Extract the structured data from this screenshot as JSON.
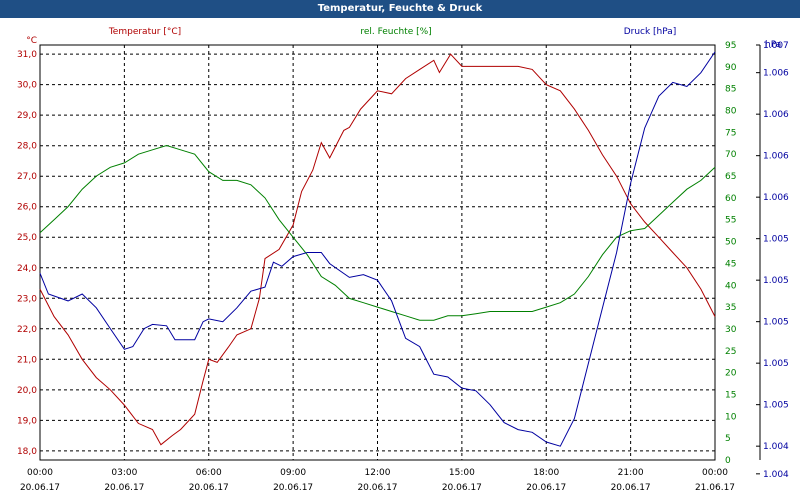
{
  "window": {
    "title": "Temperatur, Feuchte & Druck"
  },
  "chart_data": {
    "type": "line",
    "title": "Temperatur, Feuchte & Druck",
    "grid": true,
    "x_ticks": [
      {
        "time": "00:00",
        "date": "20.06.17"
      },
      {
        "time": "03:00",
        "date": "20.06.17"
      },
      {
        "time": "06:00",
        "date": "20.06.17"
      },
      {
        "time": "09:00",
        "date": "20.06.17"
      },
      {
        "time": "12:00",
        "date": "20.06.17"
      },
      {
        "time": "15:00",
        "date": "20.06.17"
      },
      {
        "time": "18:00",
        "date": "20.06.17"
      },
      {
        "time": "21:00",
        "date": "20.06.17"
      },
      {
        "time": "00:00",
        "date": "21.06.17"
      }
    ],
    "xlim": [
      0,
      24
    ],
    "axes": {
      "temperature": {
        "unit": "°C",
        "ylim": [
          17.7,
          31.3
        ],
        "ticks": [
          "31,0",
          "30,0",
          "29,0",
          "28,0",
          "27,0",
          "26,0",
          "25,0",
          "24,0",
          "23,0",
          "22,0",
          "21,0",
          "20,0",
          "19,0",
          "18,0"
        ],
        "tick_values": [
          31,
          30,
          29,
          28,
          27,
          26,
          25,
          24,
          23,
          22,
          21,
          20,
          19,
          18
        ]
      },
      "humidity": {
        "unit": "%",
        "ylim": [
          0,
          95
        ],
        "ticks": [
          "95",
          "90",
          "85",
          "80",
          "75",
          "70",
          "65",
          "60",
          "55",
          "50",
          "45",
          "40",
          "35",
          "30",
          "25",
          "20",
          "15",
          "10",
          "5",
          "0"
        ],
        "tick_values": [
          95,
          90,
          85,
          80,
          75,
          70,
          65,
          60,
          55,
          50,
          45,
          40,
          35,
          30,
          25,
          20,
          15,
          10,
          5,
          0
        ]
      },
      "pressure": {
        "unit": "hPa",
        "ylim": [
          1.004,
          1.007
        ],
        "ticks": [
          "1.007",
          "1.006",
          "1.006",
          "1.006",
          "1.006",
          "1.005",
          "1.005",
          "1.005",
          "1.005",
          "1.005",
          "1.004",
          "1.004"
        ],
        "tick_values": [
          1.007,
          1.0068,
          1.0065,
          1.0062,
          1.0059,
          1.0056,
          1.0053,
          1.005,
          1.0047,
          1.0044,
          1.0041,
          1.0039
        ]
      }
    },
    "colors": {
      "temperature": "#b00000",
      "humidity": "#008000",
      "pressure": "#0000a0",
      "grid": "#000000"
    },
    "series": [
      {
        "name": "Temperatur [°C]",
        "axis": "temperature",
        "points": [
          [
            0,
            23.3
          ],
          [
            0.5,
            22.4
          ],
          [
            1,
            21.8
          ],
          [
            1.5,
            21
          ],
          [
            2,
            20.4
          ],
          [
            2.5,
            20
          ],
          [
            3,
            19.5
          ],
          [
            3.5,
            18.9
          ],
          [
            4,
            18.7
          ],
          [
            4.3,
            18.2
          ],
          [
            4.7,
            18.5
          ],
          [
            5,
            18.7
          ],
          [
            5.5,
            19.2
          ],
          [
            5.8,
            20.3
          ],
          [
            6,
            21
          ],
          [
            6.3,
            20.9
          ],
          [
            6.7,
            21.4
          ],
          [
            7,
            21.8
          ],
          [
            7.5,
            22
          ],
          [
            7.8,
            23
          ],
          [
            8,
            24.3
          ],
          [
            8.5,
            24.6
          ],
          [
            9,
            25.4
          ],
          [
            9.3,
            26.5
          ],
          [
            9.7,
            27.2
          ],
          [
            10,
            28.1
          ],
          [
            10.3,
            27.6
          ],
          [
            10.8,
            28.5
          ],
          [
            11,
            28.6
          ],
          [
            11.4,
            29.2
          ],
          [
            11.8,
            29.6
          ],
          [
            12,
            29.8
          ],
          [
            12.5,
            29.7
          ],
          [
            13,
            30.2
          ],
          [
            13.5,
            30.5
          ],
          [
            14,
            30.8
          ],
          [
            14.2,
            30.4
          ],
          [
            14.6,
            31
          ],
          [
            15,
            30.6
          ],
          [
            15.5,
            30.6
          ],
          [
            16,
            30.6
          ],
          [
            17,
            30.6
          ],
          [
            17.5,
            30.5
          ],
          [
            18,
            30
          ],
          [
            18.5,
            29.8
          ],
          [
            19,
            29.2
          ],
          [
            19.5,
            28.5
          ],
          [
            20,
            27.7
          ],
          [
            20.5,
            27
          ],
          [
            21,
            26.1
          ],
          [
            21.5,
            25.5
          ],
          [
            22,
            25
          ],
          [
            22.5,
            24.5
          ],
          [
            23,
            24
          ],
          [
            23.5,
            23.3
          ],
          [
            24,
            22.4
          ]
        ]
      },
      {
        "name": "rel. Feuchte [%]",
        "axis": "humidity",
        "points": [
          [
            0,
            52
          ],
          [
            0.5,
            55
          ],
          [
            1,
            58
          ],
          [
            1.5,
            62
          ],
          [
            2,
            65
          ],
          [
            2.5,
            67
          ],
          [
            3,
            68
          ],
          [
            3.5,
            70
          ],
          [
            4,
            71
          ],
          [
            4.5,
            72
          ],
          [
            5,
            71
          ],
          [
            5.5,
            70
          ],
          [
            6,
            66
          ],
          [
            6.5,
            64
          ],
          [
            7,
            64
          ],
          [
            7.5,
            63
          ],
          [
            8,
            60
          ],
          [
            8.5,
            55
          ],
          [
            9,
            51
          ],
          [
            9.5,
            47
          ],
          [
            10,
            42
          ],
          [
            10.5,
            40
          ],
          [
            11,
            37
          ],
          [
            11.5,
            36
          ],
          [
            12,
            35
          ],
          [
            12.5,
            34
          ],
          [
            13,
            33
          ],
          [
            13.5,
            32
          ],
          [
            14,
            32
          ],
          [
            14.5,
            33
          ],
          [
            15,
            33
          ],
          [
            15.5,
            33.5
          ],
          [
            16,
            34
          ],
          [
            17,
            34
          ],
          [
            17.5,
            34
          ],
          [
            18,
            35
          ],
          [
            18.5,
            36
          ],
          [
            19,
            38
          ],
          [
            19.5,
            42
          ],
          [
            20,
            47
          ],
          [
            20.5,
            51
          ],
          [
            21,
            52.5
          ],
          [
            21.5,
            53
          ],
          [
            22,
            56
          ],
          [
            22.5,
            59
          ],
          [
            23,
            62
          ],
          [
            23.5,
            64
          ],
          [
            24,
            67
          ]
        ]
      },
      {
        "name": "Druck [hPa]",
        "axis": "pressure",
        "points": [
          [
            0,
            1.00535
          ],
          [
            0.3,
            1.0052
          ],
          [
            1,
            1.00515
          ],
          [
            1.5,
            1.0052
          ],
          [
            2,
            1.0051
          ],
          [
            2.5,
            1.00495
          ],
          [
            3,
            1.0048
          ],
          [
            3.3,
            1.00482
          ],
          [
            3.7,
            1.00495
          ],
          [
            4,
            1.00498
          ],
          [
            4.5,
            1.00497
          ],
          [
            4.8,
            1.00487
          ],
          [
            5.5,
            1.00487
          ],
          [
            5.8,
            1.005
          ],
          [
            6,
            1.00502
          ],
          [
            6.5,
            1.005
          ],
          [
            7,
            1.0051
          ],
          [
            7.5,
            1.00522
          ],
          [
            8,
            1.00525
          ],
          [
            8.3,
            1.00543
          ],
          [
            8.6,
            1.0054
          ],
          [
            9,
            1.00547
          ],
          [
            9.5,
            1.0055
          ],
          [
            10,
            1.0055
          ],
          [
            10.3,
            1.00542
          ],
          [
            11,
            1.00532
          ],
          [
            11.5,
            1.00534
          ],
          [
            12,
            1.0053
          ],
          [
            12.5,
            1.00515
          ],
          [
            13,
            1.00488
          ],
          [
            13.5,
            1.00482
          ],
          [
            14,
            1.00462
          ],
          [
            14.5,
            1.0046
          ],
          [
            15,
            1.00452
          ],
          [
            15.5,
            1.0045
          ],
          [
            16,
            1.0044
          ],
          [
            16.5,
            1.00427
          ],
          [
            17,
            1.00422
          ],
          [
            17.5,
            1.0042
          ],
          [
            18,
            1.00413
          ],
          [
            18.5,
            1.0041
          ],
          [
            19,
            1.0043
          ],
          [
            19.5,
            1.0047
          ],
          [
            20,
            1.0051
          ],
          [
            20.5,
            1.0055
          ],
          [
            21,
            1.006
          ],
          [
            21.5,
            1.0064
          ],
          [
            22,
            1.00663
          ],
          [
            22.5,
            1.00673
          ],
          [
            23,
            1.0067
          ],
          [
            23.5,
            1.0068
          ],
          [
            24,
            1.00695
          ]
        ]
      }
    ]
  }
}
